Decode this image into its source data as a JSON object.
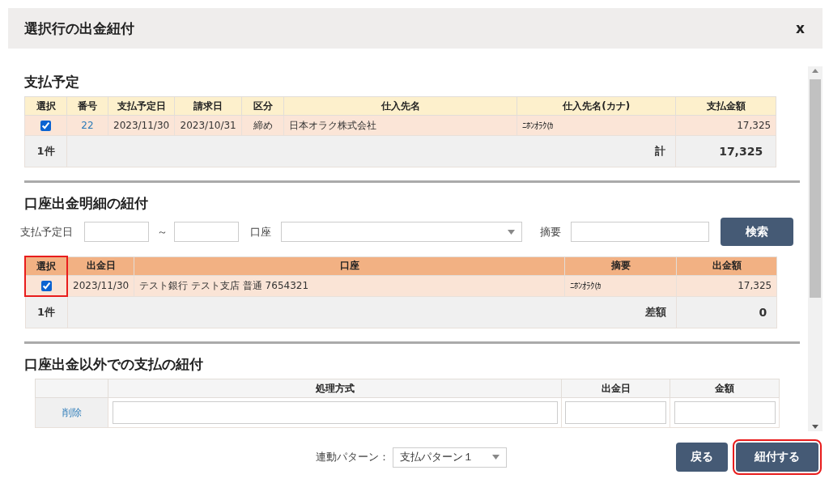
{
  "dialog": {
    "title": "選択行の出金紐付",
    "close": "x"
  },
  "schedule": {
    "title": "支払予定",
    "columns": [
      {
        "label": "選択"
      },
      {
        "label": "番号"
      },
      {
        "label": "支払予定日"
      },
      {
        "label": "請求日"
      },
      {
        "label": "区分"
      },
      {
        "label": "仕入先名"
      },
      {
        "label": "仕入先名(カナ)"
      },
      {
        "label": "支払金額"
      }
    ],
    "rows": [
      {
        "checked": true,
        "number": "22",
        "due_date": "2023/11/30",
        "invoice_date": "2023/10/31",
        "category": "締め",
        "supplier": "日本オラク株式会社",
        "supplier_kana": "ﾆﾎﾝｵﾗｸ(ｶ",
        "amount": "17,325"
      }
    ],
    "footer": {
      "count": "1件",
      "label": "計",
      "total": "17,325"
    }
  },
  "ledger": {
    "title": "口座出金明細の紐付",
    "filters": {
      "date_label": "支払予定日",
      "range_sep": "～",
      "account_label": "口座",
      "memo_label": "摘要",
      "search_button": "検索"
    },
    "columns": [
      {
        "label": "選択",
        "highlighted": true
      },
      {
        "label": "出金日",
        "highlighted": false
      },
      {
        "label": "口座",
        "highlighted": false
      },
      {
        "label": "摘要",
        "highlighted": false
      },
      {
        "label": "出金額",
        "highlighted": false
      }
    ],
    "rows": [
      {
        "checked": true,
        "date": "2023/11/30",
        "account": "テスト銀行 テスト支店 普通 7654321",
        "memo": "ﾆﾎﾝｵﾗｸ(ｶ",
        "amount": "17,325"
      }
    ],
    "footer": {
      "count": "1件",
      "label": "差額",
      "total": "0"
    }
  },
  "other": {
    "title": "口座出金以外での支払の紐付",
    "columns": [
      {
        "label": "処理方式"
      },
      {
        "label": "出金日"
      },
      {
        "label": "金額"
      }
    ],
    "rows": [
      {
        "action": "削除"
      }
    ]
  },
  "footer": {
    "pattern_label": "連動パターン：",
    "pattern_value": "支払パターン１",
    "buttons": [
      {
        "label": "戻る",
        "highlighted": false
      },
      {
        "label": "紐付する",
        "highlighted": true
      }
    ]
  }
}
